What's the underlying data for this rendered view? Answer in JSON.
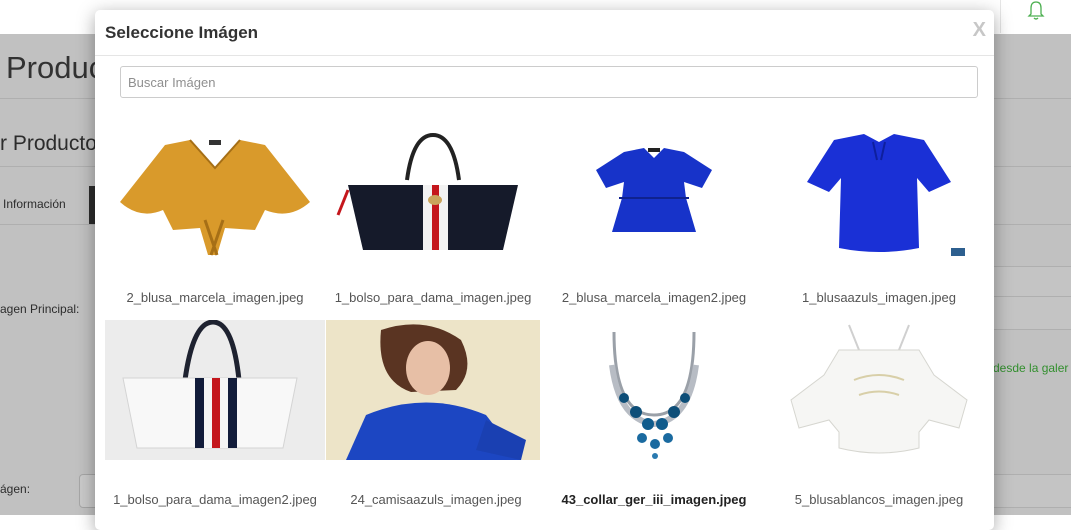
{
  "background": {
    "page_title": "Produc",
    "section_title": "r Producto",
    "tab_info_label": "Información",
    "label_main_image": "agen Principal:",
    "label_image": "ágen:",
    "gallery_link": "desde la galer"
  },
  "modal": {
    "title": "Seleccione Imágen",
    "close_label": "X",
    "search_placeholder": "Buscar Imágen",
    "images": [
      {
        "caption": "2_blusa_marcela_imagen.jpeg",
        "icon": "mustard-blouse-image"
      },
      {
        "caption": "1_bolso_para_dama_imagen.jpeg",
        "icon": "black-handbag-image"
      },
      {
        "caption": "2_blusa_marcela_imagen2.jpeg",
        "icon": "blue-ruffle-blouse-image"
      },
      {
        "caption": "1_blusaazuls_imagen.jpeg",
        "icon": "blue-blouse-image"
      },
      {
        "caption": "1_bolso_para_dama_imagen2.jpeg",
        "icon": "white-handbag-image"
      },
      {
        "caption": "24_camisaazuls_imagen.jpeg",
        "icon": "woman-blue-shirt-image"
      },
      {
        "caption": "43_collar_ger_iii_imagen.jpeg",
        "icon": "necklace-image",
        "selected": true
      },
      {
        "caption": "5_blusablancos_imagen.jpeg",
        "icon": "white-blouse-image"
      }
    ]
  },
  "colors": {
    "accent_green": "#3aa335",
    "mustard": "#d99a2b",
    "blue": "#1733c9"
  }
}
